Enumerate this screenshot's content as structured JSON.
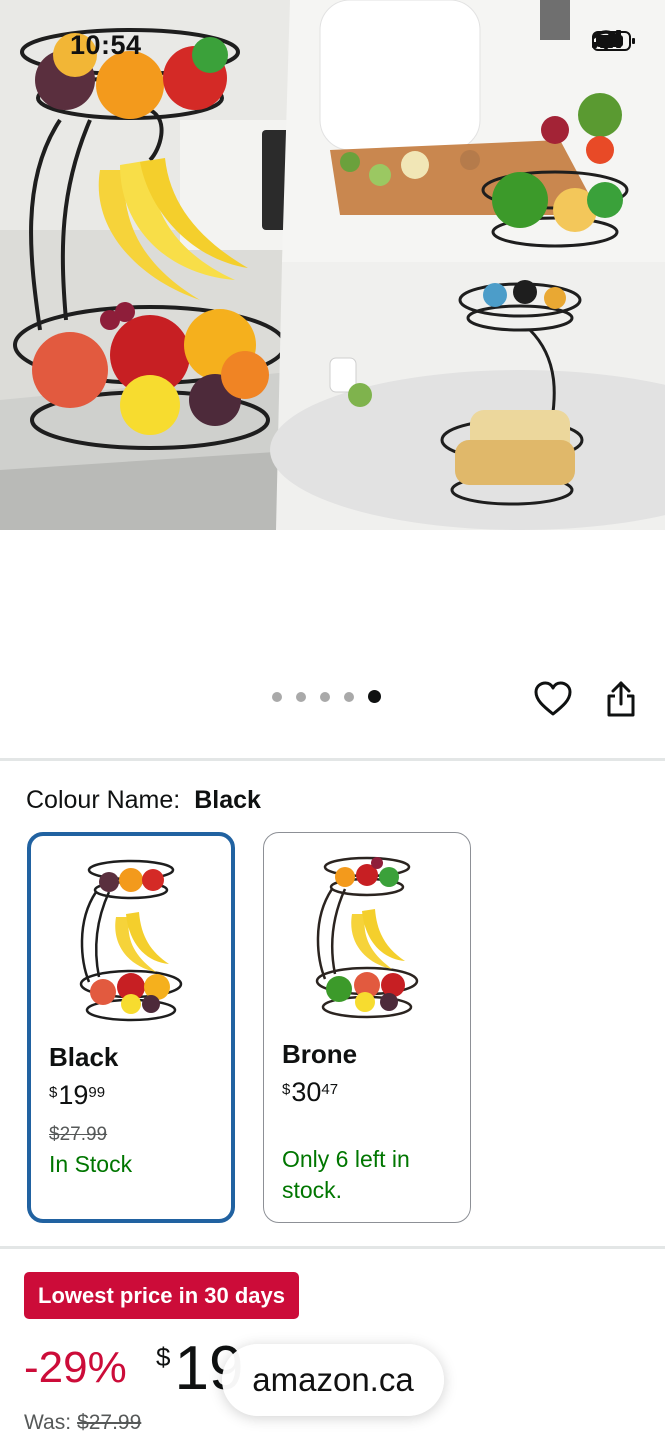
{
  "status_bar": {
    "time": "10:54",
    "icons": [
      "signal-icon",
      "wifi-icon",
      "battery-icon"
    ]
  },
  "gallery": {
    "image_count": 5,
    "active_index": 4,
    "actions": [
      "heart-icon",
      "share-icon"
    ]
  },
  "colour": {
    "label": "Colour Name:",
    "selected": "Black"
  },
  "swatches": [
    {
      "name": "Black",
      "currency": "$",
      "price_whole": "19",
      "price_fraction": "99",
      "was": "$27.99",
      "stock": "In Stock",
      "selected": true
    },
    {
      "name": "Brone",
      "currency": "$",
      "price_whole": "30",
      "price_fraction": "47",
      "stock": "Only 6 left in stock.",
      "selected": false
    }
  ],
  "deal": {
    "badge": "Lowest price in 30 days",
    "discount": "-29%",
    "currency": "$",
    "price_visible": "19",
    "was_label": "Was:",
    "was_price": "$27.99"
  },
  "browser": {
    "domain": "amazon.ca"
  },
  "colors": {
    "deal_red": "#cc0c39",
    "stock_green": "#007600",
    "selected_border": "#2162a1",
    "text": "#0f1111"
  }
}
